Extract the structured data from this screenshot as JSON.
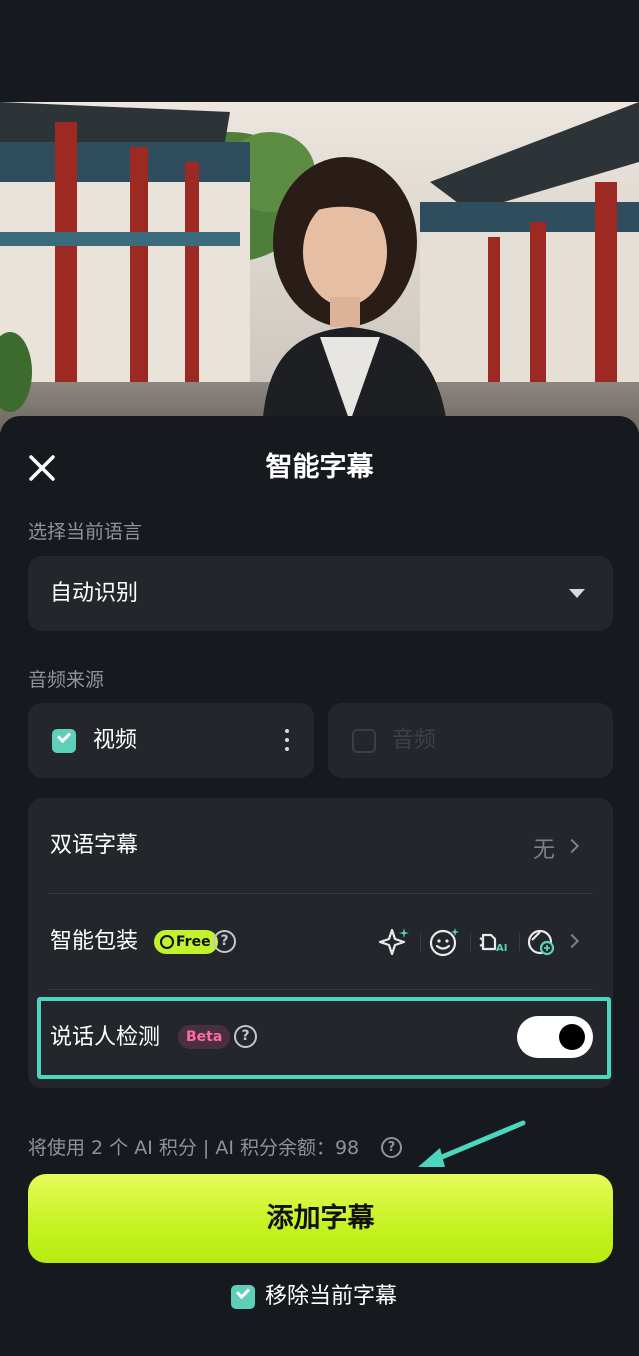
{
  "header": {
    "title": "智能字幕"
  },
  "language": {
    "section_label": "选择当前语言",
    "selected": "自动识别"
  },
  "audio_source": {
    "section_label": "音频来源",
    "options": [
      {
        "label": "视频",
        "checked": true
      },
      {
        "label": "音频",
        "checked": false
      }
    ]
  },
  "options": {
    "bilingual": {
      "label": "双语字幕",
      "value": "无"
    },
    "smart_pack": {
      "label": "智能包装",
      "badge": "Free"
    },
    "speaker": {
      "label": "说话人检测",
      "badge": "Beta",
      "enabled": true
    }
  },
  "credits": {
    "text": "将使用 2 个 AI 积分 | AI 积分余额：98"
  },
  "actions": {
    "add_label": "添加字幕",
    "remove_label": "移除当前字幕",
    "remove_checked": true
  },
  "colors": {
    "accent": "#c8f323",
    "teal": "#5ecfb9",
    "highlight": "#4dd5bf",
    "sheet": "#161a1f",
    "card": "#23272c"
  },
  "icons": [
    "close-icon",
    "caret-down-icon",
    "more-vertical-icon",
    "sparkle-icon",
    "sticker-icon",
    "ai-camera-icon",
    "template-icon",
    "chevron-right-icon",
    "help-icon",
    "arrow-annotation-icon",
    "checkbox-icon"
  ]
}
